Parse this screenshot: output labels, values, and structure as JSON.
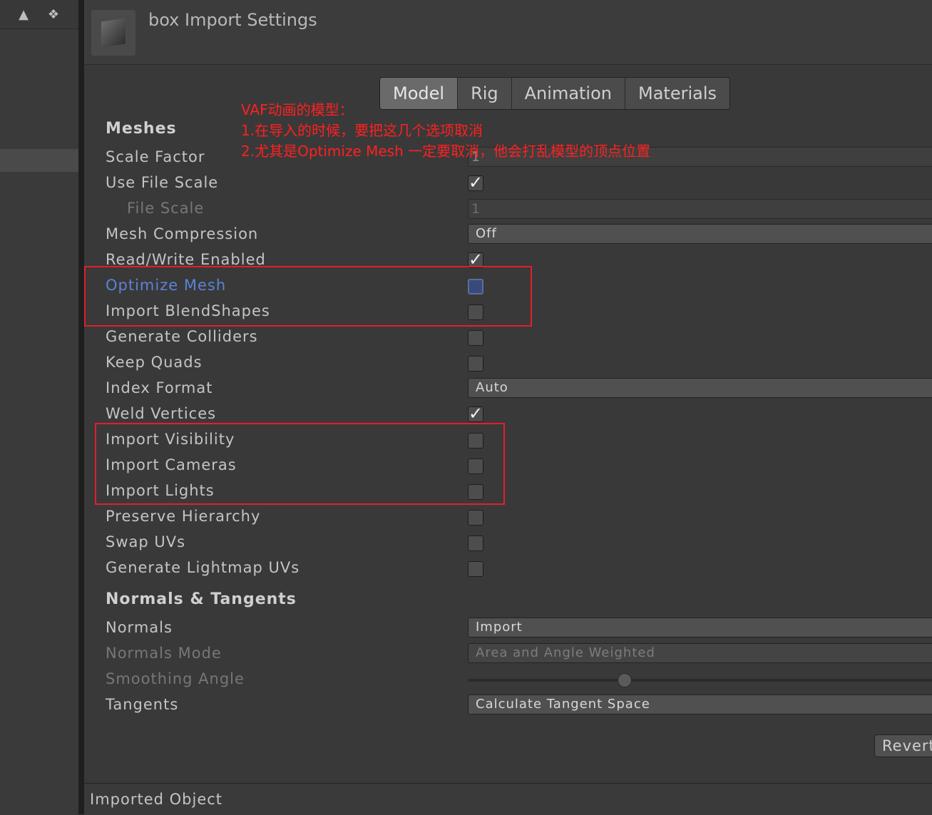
{
  "window": {
    "title": "box Import Settings"
  },
  "tabs": [
    {
      "label": "Model",
      "active": true
    },
    {
      "label": "Rig",
      "active": false
    },
    {
      "label": "Animation",
      "active": false
    },
    {
      "label": "Materials",
      "active": false
    }
  ],
  "meshes": {
    "section_title": "Meshes",
    "scale_factor": {
      "label": "Scale Factor",
      "value": "1"
    },
    "use_file_scale": {
      "label": "Use File Scale",
      "checked": true
    },
    "file_scale": {
      "label": "File Scale",
      "value": "1"
    },
    "mesh_compression": {
      "label": "Mesh Compression",
      "value": "Off"
    },
    "read_write_enabled": {
      "label": "Read/Write Enabled",
      "checked": true
    },
    "optimize_mesh": {
      "label": "Optimize Mesh",
      "checked": false
    },
    "import_blendshapes": {
      "label": "Import BlendShapes",
      "checked": false
    },
    "generate_colliders": {
      "label": "Generate Colliders",
      "checked": false
    },
    "keep_quads": {
      "label": "Keep Quads",
      "checked": false
    },
    "index_format": {
      "label": "Index Format",
      "value": "Auto"
    },
    "weld_vertices": {
      "label": "Weld Vertices",
      "checked": true
    },
    "import_visibility": {
      "label": "Import Visibility",
      "checked": false
    },
    "import_cameras": {
      "label": "Import Cameras",
      "checked": false
    },
    "import_lights": {
      "label": "Import Lights",
      "checked": false
    },
    "preserve_hierarchy": {
      "label": "Preserve Hierarchy",
      "checked": false
    },
    "swap_uvs": {
      "label": "Swap UVs",
      "checked": false
    },
    "generate_lightmap_uvs": {
      "label": "Generate Lightmap UVs",
      "checked": false
    }
  },
  "normals_tangents": {
    "section_title": "Normals & Tangents",
    "normals": {
      "label": "Normals",
      "value": "Import"
    },
    "normals_mode": {
      "label": "Normals Mode",
      "value": "Area and Angle Weighted"
    },
    "smoothing_angle": {
      "label": "Smoothing Angle"
    },
    "tangents": {
      "label": "Tangents",
      "value": "Calculate Tangent Space"
    }
  },
  "buttons": {
    "revert": "Revert"
  },
  "footer": {
    "label": "Imported Object"
  },
  "annotation": {
    "line1": "VAF动画的模型：",
    "line2": "1.在导入的时候，要把这几个选项取消",
    "line3": "2.尤其是Optimize Mesh 一定要取消，他会打乱模型的顶点位置",
    "color": "#e21f2a"
  },
  "colors": {
    "highlight_label": "#5a83d8",
    "background": "#393939"
  }
}
